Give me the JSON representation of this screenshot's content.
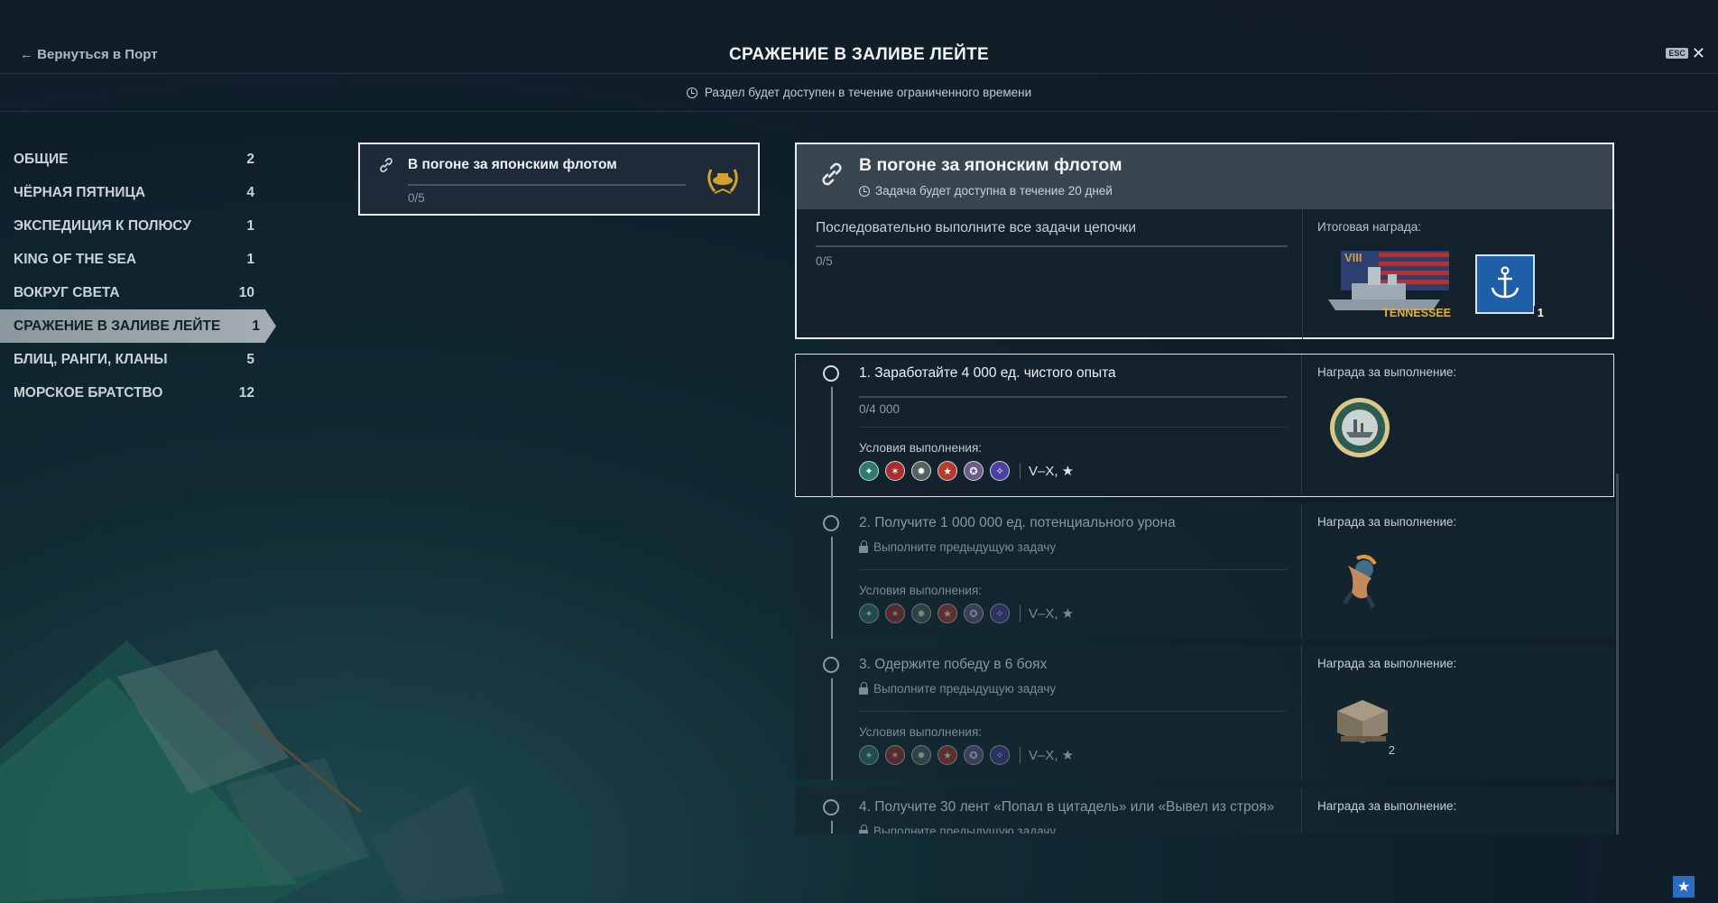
{
  "header": {
    "back_label": "← Вернуться в Порт",
    "title": "СРАЖЕНИЕ В ЗАЛИВЕ ЛЕЙТЕ",
    "esc_label": "ESC",
    "close_label": "✕"
  },
  "notice": {
    "text": "Раздел будет доступен в течение ограниченного времени"
  },
  "sidebar": {
    "items": [
      {
        "label": "ОБЩИЕ",
        "count": "2"
      },
      {
        "label": "ЧЁРНАЯ ПЯТНИЦА",
        "count": "4"
      },
      {
        "label": "ЭКСПЕДИЦИЯ К ПОЛЮСУ",
        "count": "1"
      },
      {
        "label": "KING OF THE SEA",
        "count": "1"
      },
      {
        "label": "ВОКРУГ СВЕТА",
        "count": "10"
      },
      {
        "label": "СРАЖЕНИЕ В ЗАЛИВЕ ЛЕЙТЕ",
        "count": "1"
      },
      {
        "label": "БЛИЦ, РАНГИ, КЛАНЫ",
        "count": "5"
      },
      {
        "label": "МОРСКОЕ БРАТСТВО",
        "count": "12"
      }
    ],
    "active_index": 5
  },
  "chain_card": {
    "title": "В погоне за японским флотом",
    "progress": "0/5",
    "progress_value": 0
  },
  "detail": {
    "title": "В погоне за японским флотом",
    "subtitle": "Задача будет доступна в течение 20 дней",
    "description": "Последовательно выполните все задачи цепочки",
    "progress": "0/5",
    "reward_label": "Итоговая награда:",
    "ship_tier": "VIII",
    "ship_name": "TENNESSEE",
    "anchor_count": "1"
  },
  "tasks": [
    {
      "title": "1. Заработайте 4 000 ед. чистого опыта",
      "progress": "0/4 000",
      "conditions_label": "Условия выполнения:",
      "tiers": "V–X, ★",
      "reward_label": "Награда за выполнение:",
      "reward_icon": "battle-of-leyte-gulf-patch-icon"
    },
    {
      "title": "2. Получите 1 000 000 ед. потенциального урона",
      "lock_text": "Выполните предыдущую задачу",
      "conditions_label": "Условия выполнения:",
      "tiers": "V–X, ★",
      "reward_label": "Награда за выполнение:",
      "reward_icon": "pinup-patch-icon"
    },
    {
      "title": "3. Одержите победу в 6 боях",
      "lock_text": "Выполните предыдущую задачу",
      "conditions_label": "Условия выполнения:",
      "tiers": "V–X, ★",
      "reward_label": "Награда за выполнение:",
      "reward_icon": "supply-container-icon",
      "reward_count": "2"
    },
    {
      "title": "4. Получите 30 лент «Попал в цитадель» или «Вывел из строя»",
      "lock_text": "Выполните предыдущую задачу",
      "reward_label": "Награда за выполнение:"
    }
  ],
  "nation_icons": [
    {
      "name": "nation-pan-asia-icon",
      "color": "#2e7a6d",
      "glyph": "✦"
    },
    {
      "name": "nation-ussr-icon",
      "color": "#a8302b",
      "glyph": "✶"
    },
    {
      "name": "nation-commonwealth-icon",
      "color": "#53625d",
      "glyph": "✹"
    },
    {
      "name": "nation-china-icon",
      "color": "#b73b2a",
      "glyph": "★"
    },
    {
      "name": "nation-pan-america-icon",
      "color": "#6e5a8a",
      "glyph": "✪"
    },
    {
      "name": "nation-europe-icon",
      "color": "#4b3fa0",
      "glyph": "✧"
    }
  ],
  "colors": {
    "accent_blue": "#1f5fa7",
    "active_tab": "#a4aeb4",
    "gold": "#d4a12c"
  }
}
